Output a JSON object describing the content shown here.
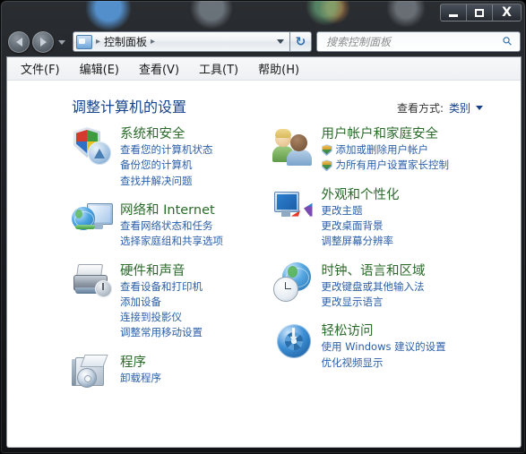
{
  "titlebar": {
    "minimize_label": "–",
    "maximize_label": "□",
    "close_label": "X"
  },
  "nav": {
    "back_title": "后退",
    "forward_title": "前进",
    "breadcrumb_root": "控制面板",
    "refresh_icon": "↻",
    "sep": "▸"
  },
  "search": {
    "placeholder": "搜索控制面板",
    "value": "",
    "icon": "search-icon"
  },
  "menu": {
    "items": [
      {
        "label": "文件(F)"
      },
      {
        "label": "编辑(E)"
      },
      {
        "label": "查看(V)"
      },
      {
        "label": "工具(T)"
      },
      {
        "label": "帮助(H)"
      }
    ]
  },
  "header": {
    "title": "调整计算机的设置",
    "view_by_label": "查看方式:",
    "view_by_value": "类别"
  },
  "colors": {
    "category_title": "#2a6b2a",
    "link": "#2b5fa8",
    "page_title": "#15428b",
    "panel_bg": "#ffffff"
  },
  "categories": {
    "left": [
      {
        "icon": "security-shield-icon",
        "title": "系统和安全",
        "links": [
          {
            "label": "查看您的计算机状态",
            "shield": false
          },
          {
            "label": "备份您的计算机",
            "shield": false
          },
          {
            "label": "查找并解决问题",
            "shield": false
          }
        ]
      },
      {
        "icon": "network-globe-icon",
        "title": "网络和 Internet",
        "links": [
          {
            "label": "查看网络状态和任务",
            "shield": false
          },
          {
            "label": "选择家庭组和共享选项",
            "shield": false
          }
        ]
      },
      {
        "icon": "printer-hardware-icon",
        "title": "硬件和声音",
        "links": [
          {
            "label": "查看设备和打印机",
            "shield": false
          },
          {
            "label": "添加设备",
            "shield": false
          },
          {
            "label": "连接到投影仪",
            "shield": false
          },
          {
            "label": "调整常用移动设置",
            "shield": false
          }
        ]
      },
      {
        "icon": "programs-disc-icon",
        "title": "程序",
        "links": [
          {
            "label": "卸载程序",
            "shield": false
          }
        ]
      }
    ],
    "right": [
      {
        "icon": "user-accounts-icon",
        "title": "用户帐户和家庭安全",
        "links": [
          {
            "label": "添加或删除用户帐户",
            "shield": true
          },
          {
            "label": "为所有用户设置家长控制",
            "shield": true
          }
        ]
      },
      {
        "icon": "appearance-monitor-icon",
        "title": "外观和个性化",
        "links": [
          {
            "label": "更改主题",
            "shield": false
          },
          {
            "label": "更改桌面背景",
            "shield": false
          },
          {
            "label": "调整屏幕分辨率",
            "shield": false
          }
        ]
      },
      {
        "icon": "clock-language-icon",
        "title": "时钟、语言和区域",
        "links": [
          {
            "label": "更改键盘或其他输入法",
            "shield": false
          },
          {
            "label": "更改显示语言",
            "shield": false
          }
        ]
      },
      {
        "icon": "ease-of-access-icon",
        "title": "轻松访问",
        "links": [
          {
            "label": "使用 Windows 建议的设置",
            "shield": false
          },
          {
            "label": "优化视频显示",
            "shield": false
          }
        ]
      }
    ]
  }
}
